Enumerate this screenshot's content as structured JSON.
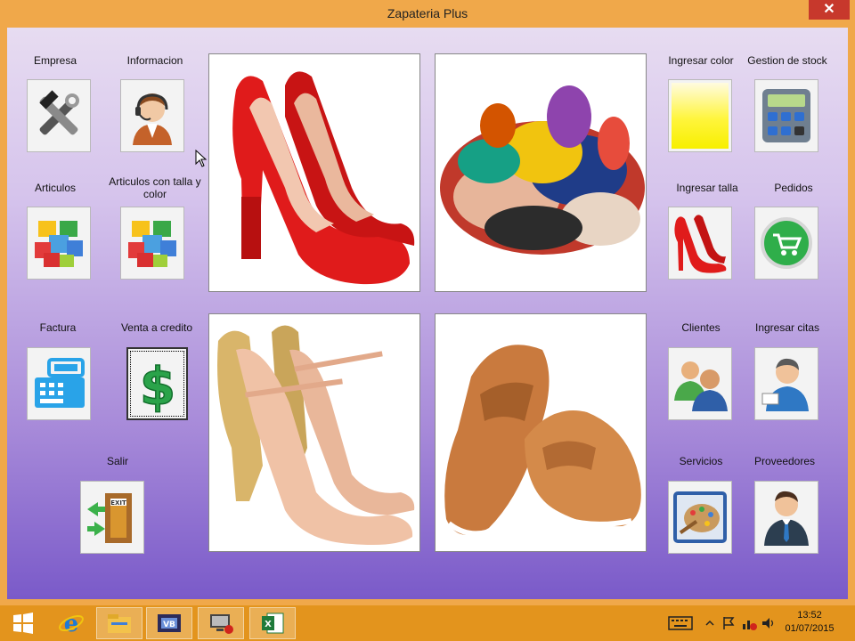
{
  "window": {
    "title": "Zapateria Plus",
    "close_label": "✕"
  },
  "buttons": {
    "empresa": "Empresa",
    "informacion": "Informacion",
    "articulos": "Articulos",
    "articulos_talla_color": "Articulos con talla y color",
    "factura": "Factura",
    "venta_credito": "Venta a credito",
    "salir": "Salir",
    "ingresar_color": "Ingresar color",
    "gestion_stock": "Gestion de stock",
    "ingresar_talla": "Ingresar talla",
    "pedidos": "Pedidos",
    "clientes": "Clientes",
    "ingresar_citas": "Ingresar citas",
    "servicios": "Servicios",
    "proveedores": "Proveedores"
  },
  "icons": {
    "empresa": "tools-icon",
    "informacion": "support-agent-icon",
    "articulos": "cubes-icon",
    "articulos_talla_color": "cubes-icon",
    "factura": "cash-register-icon",
    "venta_credito": "dollar-icon",
    "salir": "exit-door-icon",
    "ingresar_color": "color-gradient-icon",
    "gestion_stock": "calculator-icon",
    "ingresar_talla": "red-heels-icon",
    "pedidos": "shopping-cart-icon",
    "clientes": "users-icon",
    "ingresar_citas": "user-badge-icon",
    "servicios": "palette-icon",
    "proveedores": "businessman-icon"
  },
  "showcase": [
    "red-high-heels",
    "pile-of-shoes",
    "nude-glitter-heels",
    "brown-loafers"
  ],
  "taskbar": {
    "apps": [
      "windows-start-icon",
      "internet-explorer-icon",
      "file-explorer-icon",
      "media-app-icon",
      "remote-desktop-icon",
      "excel-icon"
    ],
    "time": "13:52",
    "date": "01/07/2015"
  },
  "colors": {
    "title_bar": "#f0a84a",
    "client_top": "#e7dcf1",
    "client_bottom": "#7a5ac9",
    "taskbar": "#e3941d"
  }
}
